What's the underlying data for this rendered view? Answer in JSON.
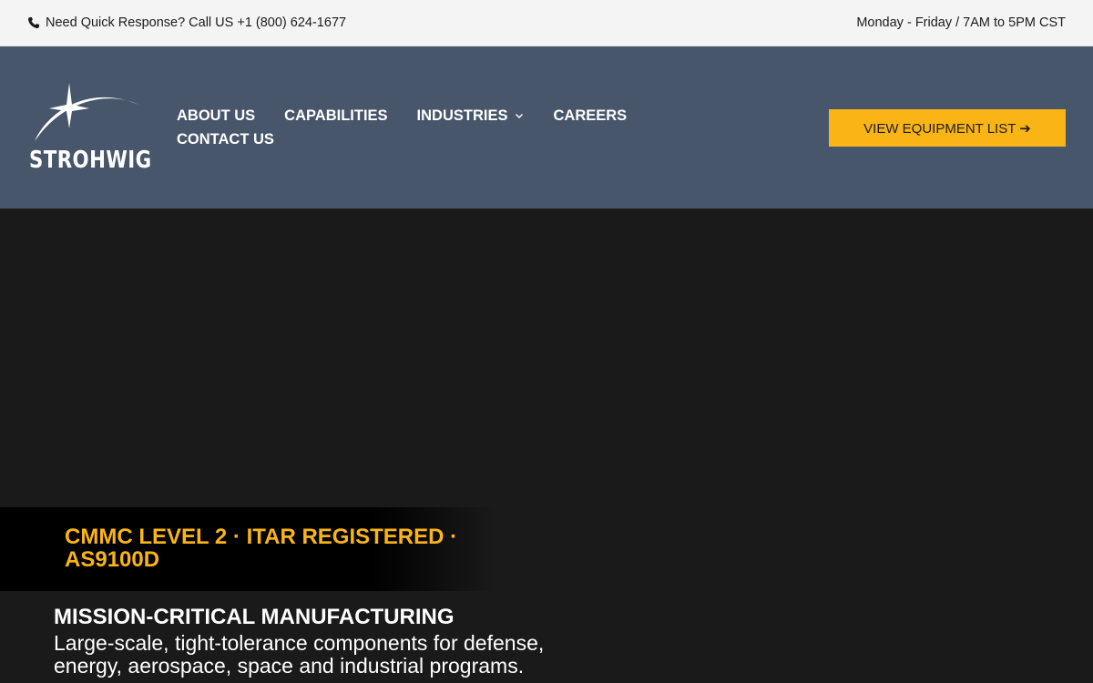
{
  "topbar": {
    "phone_text": "Need Quick Response? Call US +1 (800) 624-1677",
    "hours_text": "Monday - Friday / 7AM to 5PM CST",
    "phone_icon": "phone-icon"
  },
  "logo": {
    "text": "STROHWIG"
  },
  "nav": {
    "items": [
      {
        "label": "ABOUT US"
      },
      {
        "label": "CAPABILITIES"
      },
      {
        "label": "INDUSTRIES",
        "has_dropdown": true
      },
      {
        "label": "CAREERS"
      },
      {
        "label": "CONTACT US"
      }
    ]
  },
  "cta": {
    "label": "VIEW EQUIPMENT LIST ➔"
  },
  "hero": {
    "certifications": "CMMC LEVEL 2 · ITAR REGISTERED · AS9100D",
    "title": "MISSION-CRITICAL MANUFACTURING",
    "subtitle": "Large-scale, tight-tolerance components for defense, energy, aerospace, space and industrial programs."
  },
  "colors": {
    "accent": "#fbb416",
    "header_bg": "#47566a",
    "topbar_bg": "#f4f4f4",
    "hero_bg": "#1a1a1a"
  }
}
